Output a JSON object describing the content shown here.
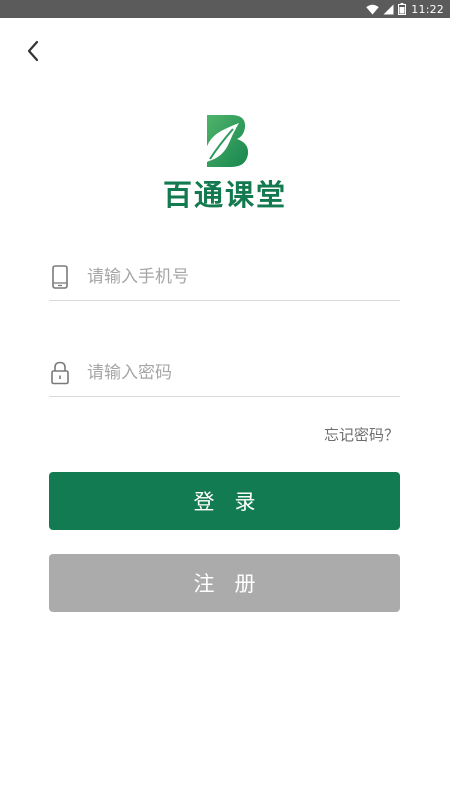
{
  "status_bar": {
    "time": "11:22",
    "icons": [
      "wifi-icon",
      "signal-icon",
      "battery-icon"
    ]
  },
  "nav": {
    "back_icon": "chevron-left-icon"
  },
  "brand": {
    "name": "百通课堂",
    "logo_letter": "B",
    "color": "#127a4e"
  },
  "form": {
    "phone": {
      "placeholder": "请输入手机号",
      "value": "",
      "icon": "phone-icon"
    },
    "password": {
      "placeholder": "请输入密码",
      "value": "",
      "icon": "lock-icon"
    },
    "forgot_label": "忘记密码？"
  },
  "buttons": {
    "login_label": "登录",
    "register_label": "注册",
    "login_color": "#137b52",
    "register_color": "#ababab"
  }
}
